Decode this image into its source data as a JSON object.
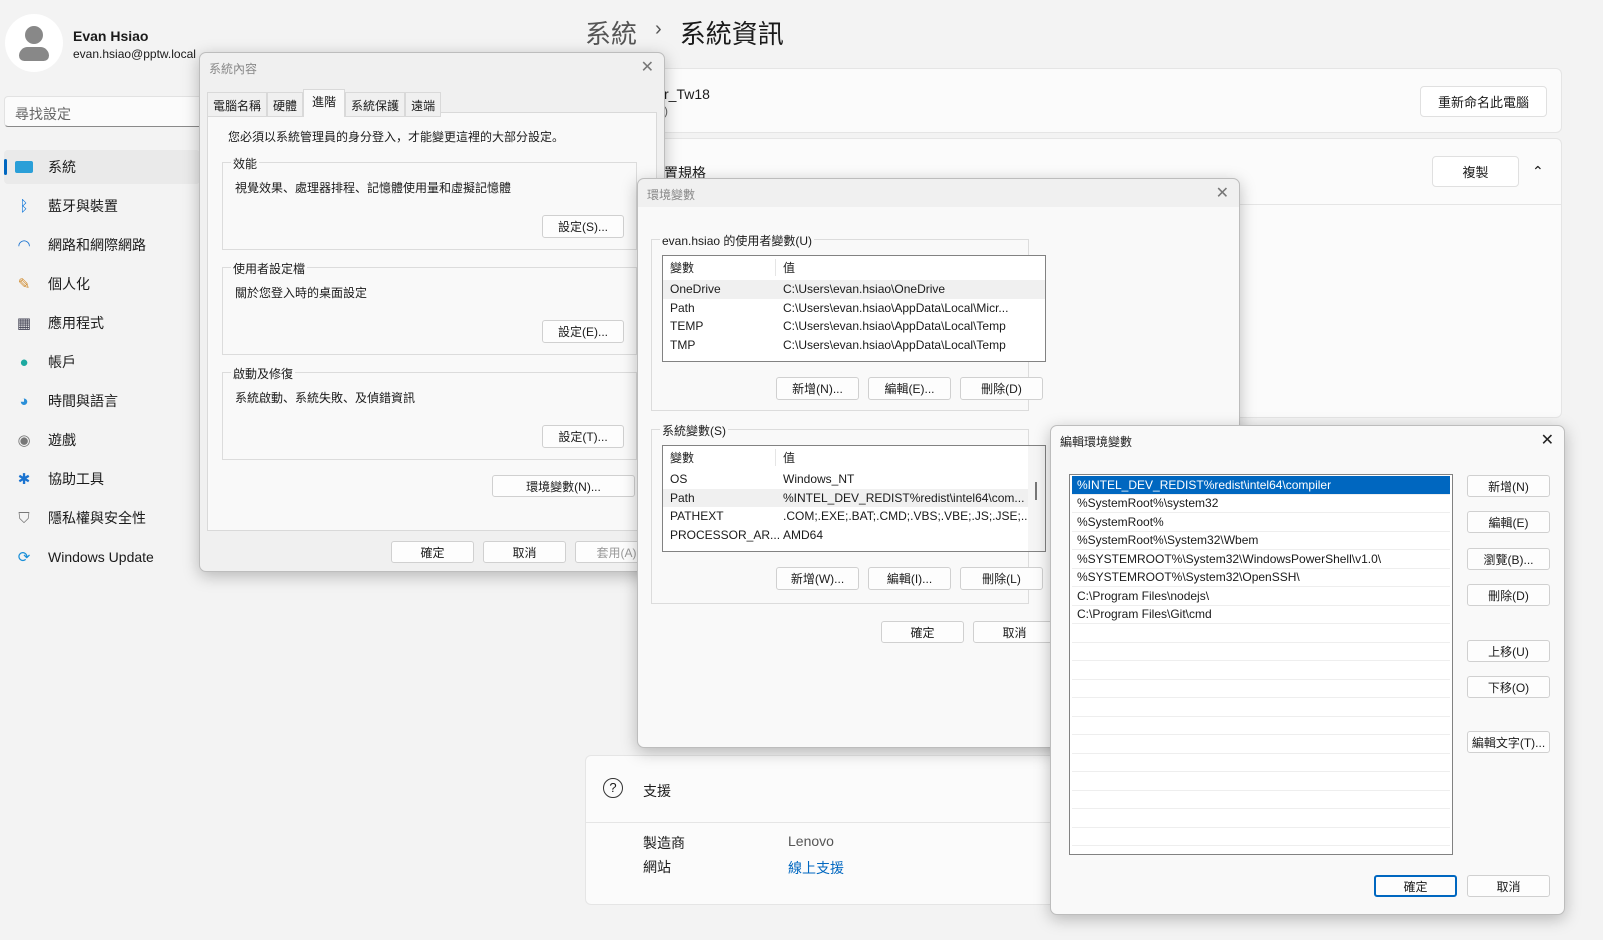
{
  "user": {
    "name": "Evan Hsiao",
    "email": "evan.hsiao@pptw.local"
  },
  "search": {
    "placeholder": "尋找設定"
  },
  "nav": [
    {
      "label": "系統",
      "icon": "monitor-icon",
      "selected": true
    },
    {
      "label": "藍牙與裝置",
      "icon": "bluetooth-icon"
    },
    {
      "label": "網路和網際網路",
      "icon": "wifi-icon"
    },
    {
      "label": "個人化",
      "icon": "brush-icon"
    },
    {
      "label": "應用程式",
      "icon": "apps-icon"
    },
    {
      "label": "帳戶",
      "icon": "person-icon"
    },
    {
      "label": "時間與語言",
      "icon": "globe-clock-icon"
    },
    {
      "label": "遊戲",
      "icon": "gamepad-icon"
    },
    {
      "label": "協助工具",
      "icon": "accessibility-icon"
    },
    {
      "label": "隱私權與安全性",
      "icon": "shield-icon"
    },
    {
      "label": "Windows Update",
      "icon": "update-icon"
    }
  ],
  "header": {
    "crumb1": "系統",
    "sep": "›",
    "crumb2": "系統資訊"
  },
  "main": {
    "device_name": "r_Tw18",
    "device_sub": ")",
    "rename": "重新命名此電腦",
    "spec": "置規格",
    "copy": "複製",
    "support": "支援",
    "manufacturer_label": "製造商",
    "manufacturer": "Lenovo",
    "website_label": "網站",
    "website": "線上支援",
    "accent": "#0067c0"
  },
  "sysprop": {
    "title": "系統內容",
    "tabs": [
      "電腦名稱",
      "硬體",
      "進階",
      "系統保護",
      "遠端"
    ],
    "active_tab": 2,
    "note": "您必須以系統管理員的身分登入，才能變更這裡的大部分設定。",
    "groups": [
      {
        "label": "效能",
        "desc": "視覺效果、處理器排程、記憶體使用量和虛擬記憶體",
        "button": "設定(S)..."
      },
      {
        "label": "使用者設定檔",
        "desc": "關於您登入時的桌面設定",
        "button": "設定(E)..."
      },
      {
        "label": "啟動及修復",
        "desc": "系統啟動、系統失敗、及偵錯資訊",
        "button": "設定(T)..."
      }
    ],
    "env_button": "環境變數(N)...",
    "ok": "確定",
    "cancel": "取消",
    "apply": "套用(A)"
  },
  "envvars": {
    "title": "環境變數",
    "user_group": "evan.hsiao 的使用者變數(U)",
    "col_var": "變數",
    "col_val": "值",
    "user_vars": [
      [
        "OneDrive",
        "C:\\Users\\evan.hsiao\\OneDrive"
      ],
      [
        "Path",
        "C:\\Users\\evan.hsiao\\AppData\\Local\\Micr..."
      ],
      [
        "TEMP",
        "C:\\Users\\evan.hsiao\\AppData\\Local\\Temp"
      ],
      [
        "TMP",
        "C:\\Users\\evan.hsiao\\AppData\\Local\\Temp"
      ]
    ],
    "user_buttons": [
      "新增(N)...",
      "編輯(E)...",
      "刪除(D)"
    ],
    "sys_group": "系統變數(S)",
    "sys_vars": [
      [
        "OS",
        "Windows_NT"
      ],
      [
        "Path",
        "%INTEL_DEV_REDIST%redist\\intel64\\com..."
      ],
      [
        "PATHEXT",
        ".COM;.EXE;.BAT;.CMD;.VBS;.VBE;.JS;.JSE;...."
      ],
      [
        "PROCESSOR_AR...",
        "AMD64"
      ]
    ],
    "sys_buttons": [
      "新增(W)...",
      "編輯(I)...",
      "刪除(L)"
    ],
    "ok": "確定",
    "cancel": "取消"
  },
  "editenv": {
    "title": "編輯環境變數",
    "entries": [
      "%INTEL_DEV_REDIST%redist\\intel64\\compiler",
      "%SystemRoot%\\system32",
      "%SystemRoot%",
      "%SystemRoot%\\System32\\Wbem",
      "%SYSTEMROOT%\\System32\\WindowsPowerShell\\v1.0\\",
      "%SYSTEMROOT%\\System32\\OpenSSH\\",
      "C:\\Program Files\\nodejs\\",
      "C:\\Program Files\\Git\\cmd"
    ],
    "selected": 0,
    "buttons": [
      "新增(N)",
      "編輯(E)",
      "瀏覽(B)...",
      "刪除(D)",
      "上移(U)",
      "下移(O)",
      "編輯文字(T)..."
    ],
    "ok": "確定",
    "cancel": "取消"
  }
}
